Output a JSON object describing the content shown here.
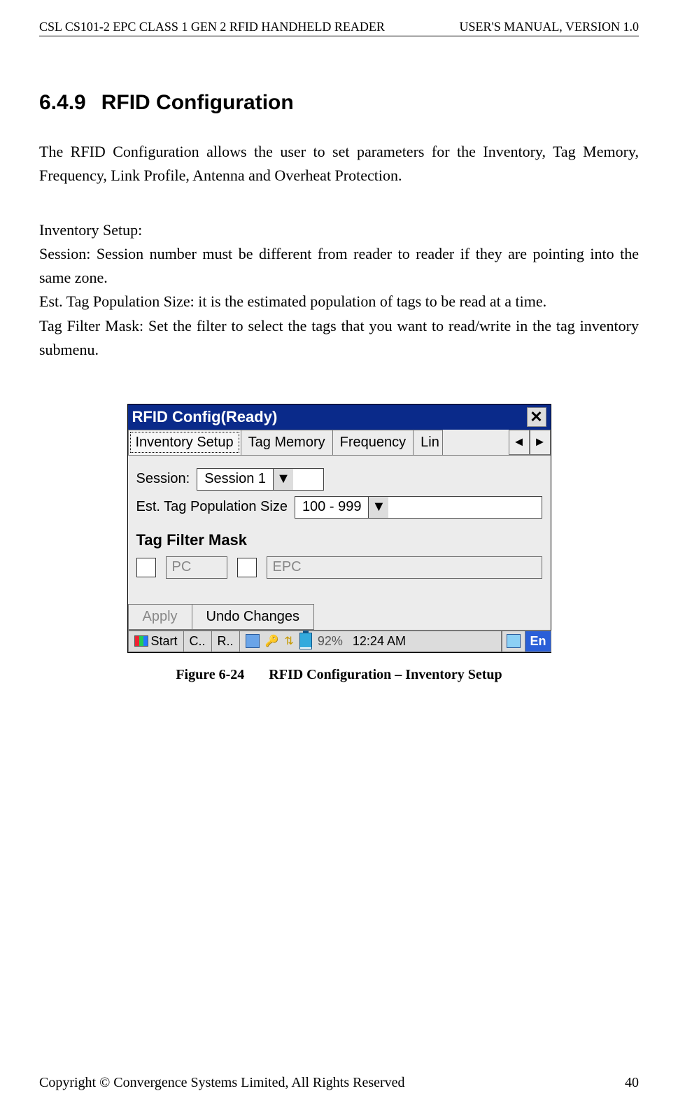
{
  "header": {
    "left": "CSL CS101-2 EPC CLASS 1 GEN 2 RFID HANDHELD READER",
    "right": "USER'S  MANUAL,  VERSION  1.0"
  },
  "section": {
    "number": "6.4.9",
    "title": "RFID Configuration"
  },
  "paragraphs": {
    "intro": "The RFID Configuration allows the user to set parameters for the Inventory, Tag Memory, Frequency, Link Profile, Antenna and Overheat Protection.",
    "inventory_heading": "Inventory Setup:",
    "session": "Session: Session number must be different from reader to reader if they are pointing into the same zone.",
    "est": "Est. Tag Population Size: it is the estimated population of tags to be read at a time.",
    "filter": "Tag Filter Mask: Set the filter to select the tags that you want to read/write in the tag inventory submenu."
  },
  "dialog": {
    "title": "RFID Config(Ready)",
    "close_glyph": "✕",
    "tabs": {
      "inventory": "Inventory Setup",
      "tag_memory": "Tag Memory",
      "frequency": "Frequency",
      "link_cut": "Lin",
      "scroll_left": "◄",
      "scroll_right": "►"
    },
    "fields": {
      "session_label": "Session:",
      "session_value": "Session 1",
      "est_label": "Est. Tag Population Size",
      "est_value": "100 - 999",
      "mask_heading": "Tag Filter Mask",
      "pc_label": "PC",
      "epc_label": "EPC"
    },
    "buttons": {
      "apply": "Apply",
      "undo": "Undo Changes"
    },
    "taskbar": {
      "start": "Start",
      "app1": "C..",
      "app2": "R..",
      "battery_pct": "92%",
      "time": "12:24 AM",
      "ime": "En"
    },
    "dropdown_glyph": "▼"
  },
  "caption": {
    "fig_label": "Figure 6-24",
    "fig_text": "RFID Configuration – Inventory Setup"
  },
  "footer": {
    "copyright": "Copyright © Convergence Systems Limited, All Rights Reserved",
    "page_no": "40"
  }
}
